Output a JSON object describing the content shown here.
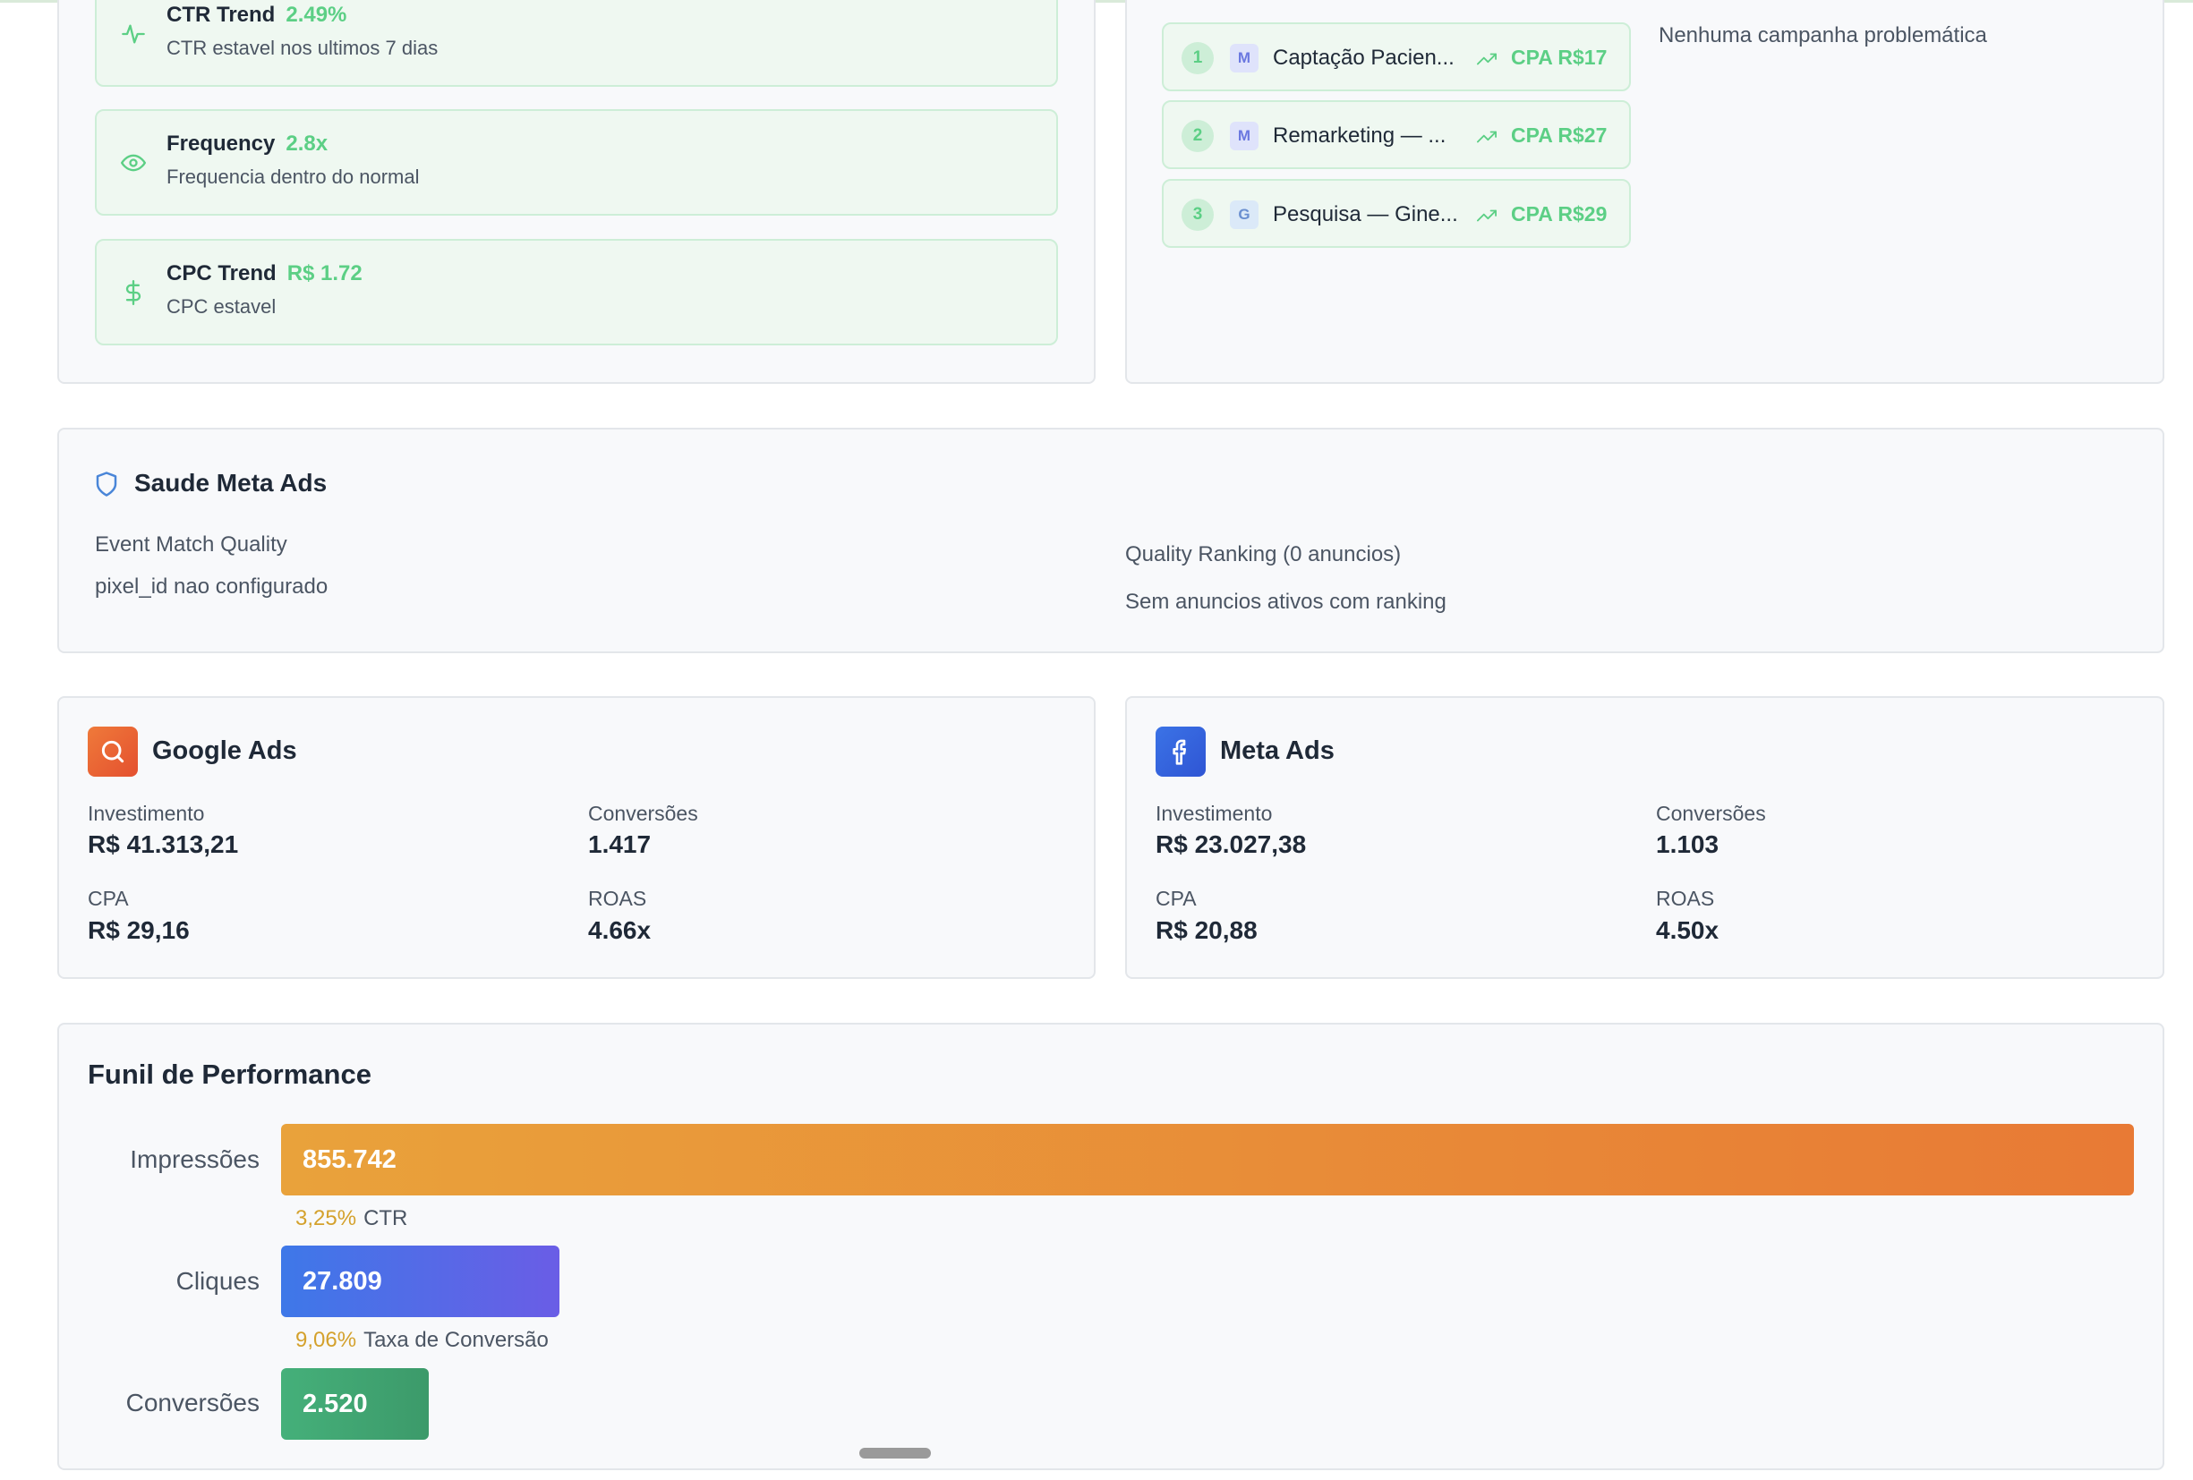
{
  "trends": [
    {
      "title": "CTR Trend",
      "value": "2.49%",
      "subtitle": "CTR estavel nos ultimos 7 dias",
      "icon": "activity-icon"
    },
    {
      "title": "Frequency",
      "value": "2.8x",
      "subtitle": "Frequencia dentro do normal",
      "icon": "eye-icon"
    },
    {
      "title": "CPC Trend",
      "value": "R$ 1.72",
      "subtitle": "CPC estavel",
      "icon": "dollar-icon"
    }
  ],
  "top_campaigns": [
    {
      "rank": "1",
      "platform": "M",
      "name": "Captação Pacien...",
      "cpa": "CPA R$17"
    },
    {
      "rank": "2",
      "platform": "M",
      "name": "Remarketing — ...",
      "cpa": "CPA R$27"
    },
    {
      "rank": "3",
      "platform": "G",
      "name": "Pesquisa — Gine...",
      "cpa": "CPA R$29"
    }
  ],
  "problem_campaigns": {
    "empty_text": "Nenhuma campanha problemática"
  },
  "meta_health": {
    "title": "Saude Meta Ads",
    "emq_label": "Event Match Quality",
    "emq_value": "pixel_id nao configurado",
    "ranking_label": "Quality Ranking (0 anuncios)",
    "ranking_value": "Sem anuncios ativos com ranking"
  },
  "google_ads": {
    "title": "Google Ads",
    "investimento_label": "Investimento",
    "investimento": "R$ 41.313,21",
    "conversoes_label": "Conversões",
    "conversoes": "1.417",
    "cpa_label": "CPA",
    "cpa": "R$ 29,16",
    "roas_label": "ROAS",
    "roas": "4.66x"
  },
  "meta_ads": {
    "title": "Meta Ads",
    "investimento_label": "Investimento",
    "investimento": "R$ 23.027,38",
    "conversoes_label": "Conversões",
    "conversoes": "1.103",
    "cpa_label": "CPA",
    "cpa": "R$ 20,88",
    "roas_label": "ROAS",
    "roas": "4.50x"
  },
  "funnel": {
    "title": "Funil de Performance",
    "stages": [
      {
        "label": "Impressões",
        "value": "855.742"
      },
      {
        "label": "Cliques",
        "value": "27.809"
      },
      {
        "label": "Conversões",
        "value": "2.520"
      }
    ],
    "rates": [
      {
        "pct": "3,25%",
        "label": "CTR"
      },
      {
        "pct": "9,06%",
        "label": "Taxa de Conversão"
      }
    ]
  },
  "colors": {
    "positive": "#5ccf85",
    "google_gradient": [
      "#ef6d3a",
      "#e8502f"
    ],
    "meta_gradient": [
      "#3b73e6",
      "#2f55d4"
    ],
    "impressions_gradient": [
      "#e9a23b",
      "#e87a35"
    ],
    "clicks_gradient": [
      "#3e78e8",
      "#6a5de6"
    ],
    "conversions_gradient": [
      "#45b07a",
      "#3c9a6a"
    ]
  }
}
